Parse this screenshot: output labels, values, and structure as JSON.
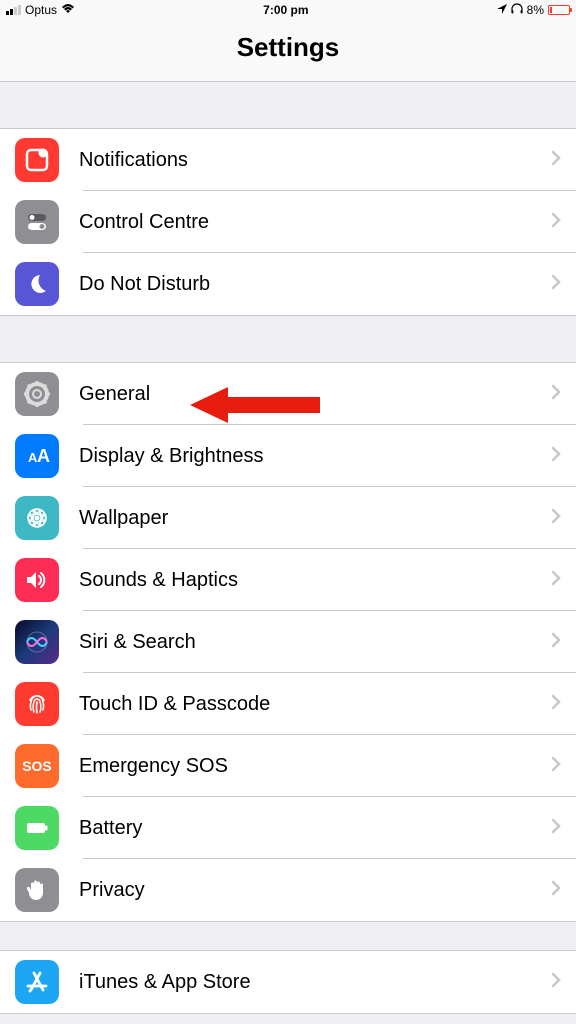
{
  "status_bar": {
    "carrier": "Optus",
    "time": "7:00 pm",
    "battery_pct": "8%"
  },
  "header": {
    "title": "Settings"
  },
  "groups": [
    {
      "rows": [
        {
          "id": "notifications",
          "label": "Notifications",
          "icon": "notifications"
        },
        {
          "id": "control-centre",
          "label": "Control Centre",
          "icon": "control-centre"
        },
        {
          "id": "dnd",
          "label": "Do Not Disturb",
          "icon": "dnd"
        }
      ]
    },
    {
      "rows": [
        {
          "id": "general",
          "label": "General",
          "icon": "general"
        },
        {
          "id": "display",
          "label": "Display & Brightness",
          "icon": "display"
        },
        {
          "id": "wallpaper",
          "label": "Wallpaper",
          "icon": "wallpaper"
        },
        {
          "id": "sounds",
          "label": "Sounds & Haptics",
          "icon": "sounds"
        },
        {
          "id": "siri",
          "label": "Siri & Search",
          "icon": "siri"
        },
        {
          "id": "touchid",
          "label": "Touch ID & Passcode",
          "icon": "touchid"
        },
        {
          "id": "sos",
          "label": "Emergency SOS",
          "icon": "sos"
        },
        {
          "id": "battery",
          "label": "Battery",
          "icon": "battery"
        },
        {
          "id": "privacy",
          "label": "Privacy",
          "icon": "privacy"
        }
      ]
    },
    {
      "rows": [
        {
          "id": "itunes",
          "label": "iTunes & App Store",
          "icon": "itunes"
        }
      ]
    }
  ],
  "annotation": {
    "arrow_points_to": "general"
  },
  "sos_text": "SOS"
}
